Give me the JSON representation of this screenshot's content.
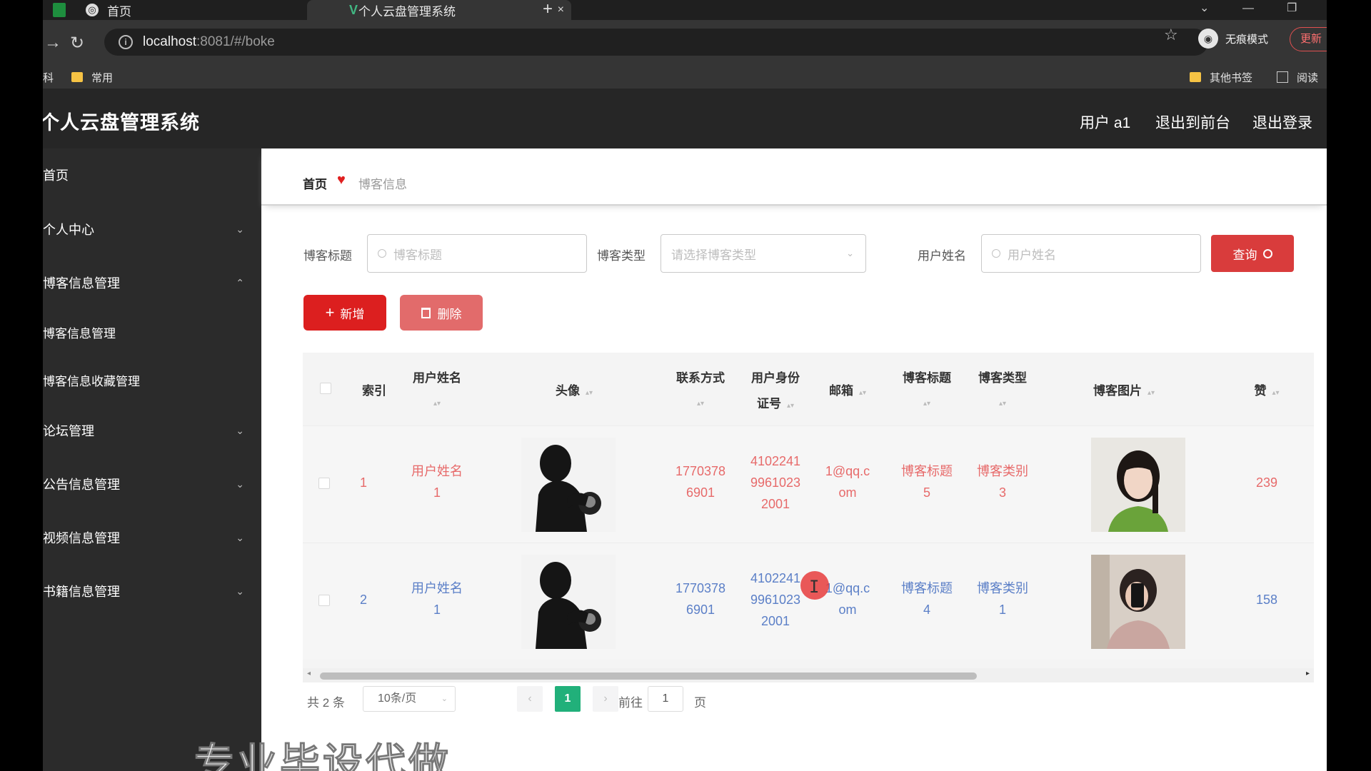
{
  "browser": {
    "tabs": [
      {
        "title": "首页",
        "close": "×"
      },
      {
        "title": "个人云盘管理系统",
        "close": "×"
      }
    ],
    "new_tab": "+",
    "url_host": "localhost",
    "url_path": ":8081/#/boke",
    "incognito_label": "无痕模式",
    "update_label": "更新",
    "bookmarks": {
      "left_partial": "科",
      "common": "常用",
      "other": "其他书签",
      "reader": "阅读"
    }
  },
  "app": {
    "title": "个人云盘管理系统",
    "header_links": {
      "user": "用户 a1",
      "to_front": "退出到前台",
      "logout": "退出登录"
    }
  },
  "sidebar": {
    "items": [
      {
        "label": "首页"
      },
      {
        "label": "个人中心"
      },
      {
        "label": "博客信息管理"
      },
      {
        "label": "博客信息管理"
      },
      {
        "label": "博客信息收藏管理"
      },
      {
        "label": "论坛管理"
      },
      {
        "label": "公告信息管理"
      },
      {
        "label": "视频信息管理"
      },
      {
        "label": "书籍信息管理"
      }
    ]
  },
  "breadcrumb": {
    "home": "首页",
    "current": "博客信息"
  },
  "filters": {
    "title_label": "博客标题",
    "title_placeholder": "博客标题",
    "type_label": "博客类型",
    "type_placeholder": "请选择博客类型",
    "user_label": "用户姓名",
    "user_placeholder": "用户姓名",
    "query_button": "查询"
  },
  "actions": {
    "add": "新增",
    "delete": "删除"
  },
  "table": {
    "headers": {
      "index": "索引",
      "user_name_1": "用户姓名",
      "avatar": "头像",
      "phone_1": "联系方式",
      "id_1": "用户身份",
      "id_2": "证号",
      "email": "邮箱",
      "blog_title": "博客标题",
      "blog_type": "博客类型",
      "blog_image": "博客图片",
      "likes": "赞"
    },
    "rows": [
      {
        "index": "1",
        "name_a": "用户姓名",
        "name_b": "1",
        "phone_a": "1770378",
        "phone_b": "6901",
        "id_a": "4102241",
        "id_b": "9961023",
        "id_c": "2001",
        "email_a": "1@qq.c",
        "email_b": "om",
        "title_a": "博客标题",
        "title_b": "5",
        "type_a": "博客类别",
        "type_b": "3",
        "likes": "239"
      },
      {
        "index": "2",
        "name_a": "用户姓名",
        "name_b": "1",
        "phone_a": "1770378",
        "phone_b": "6901",
        "id_a": "4102241",
        "id_b": "9961023",
        "id_c": "2001",
        "email_a": "1@qq.c",
        "email_b": "om",
        "title_a": "博客标题",
        "title_b": "4",
        "type_a": "博客类别",
        "type_b": "1",
        "likes": "158"
      }
    ]
  },
  "pagination": {
    "total": "共 2 条",
    "page_size": "10条/页",
    "current_page": "1",
    "goto_label": "前往",
    "goto_value": "1",
    "page_unit": "页"
  },
  "overlay_text": "专业毕设代做",
  "colors": {
    "accent_red": "#dc1f1f",
    "pager_active": "#21b07a",
    "sidebar_bg": "#2b2b2b",
    "header_bg": "#262626"
  }
}
